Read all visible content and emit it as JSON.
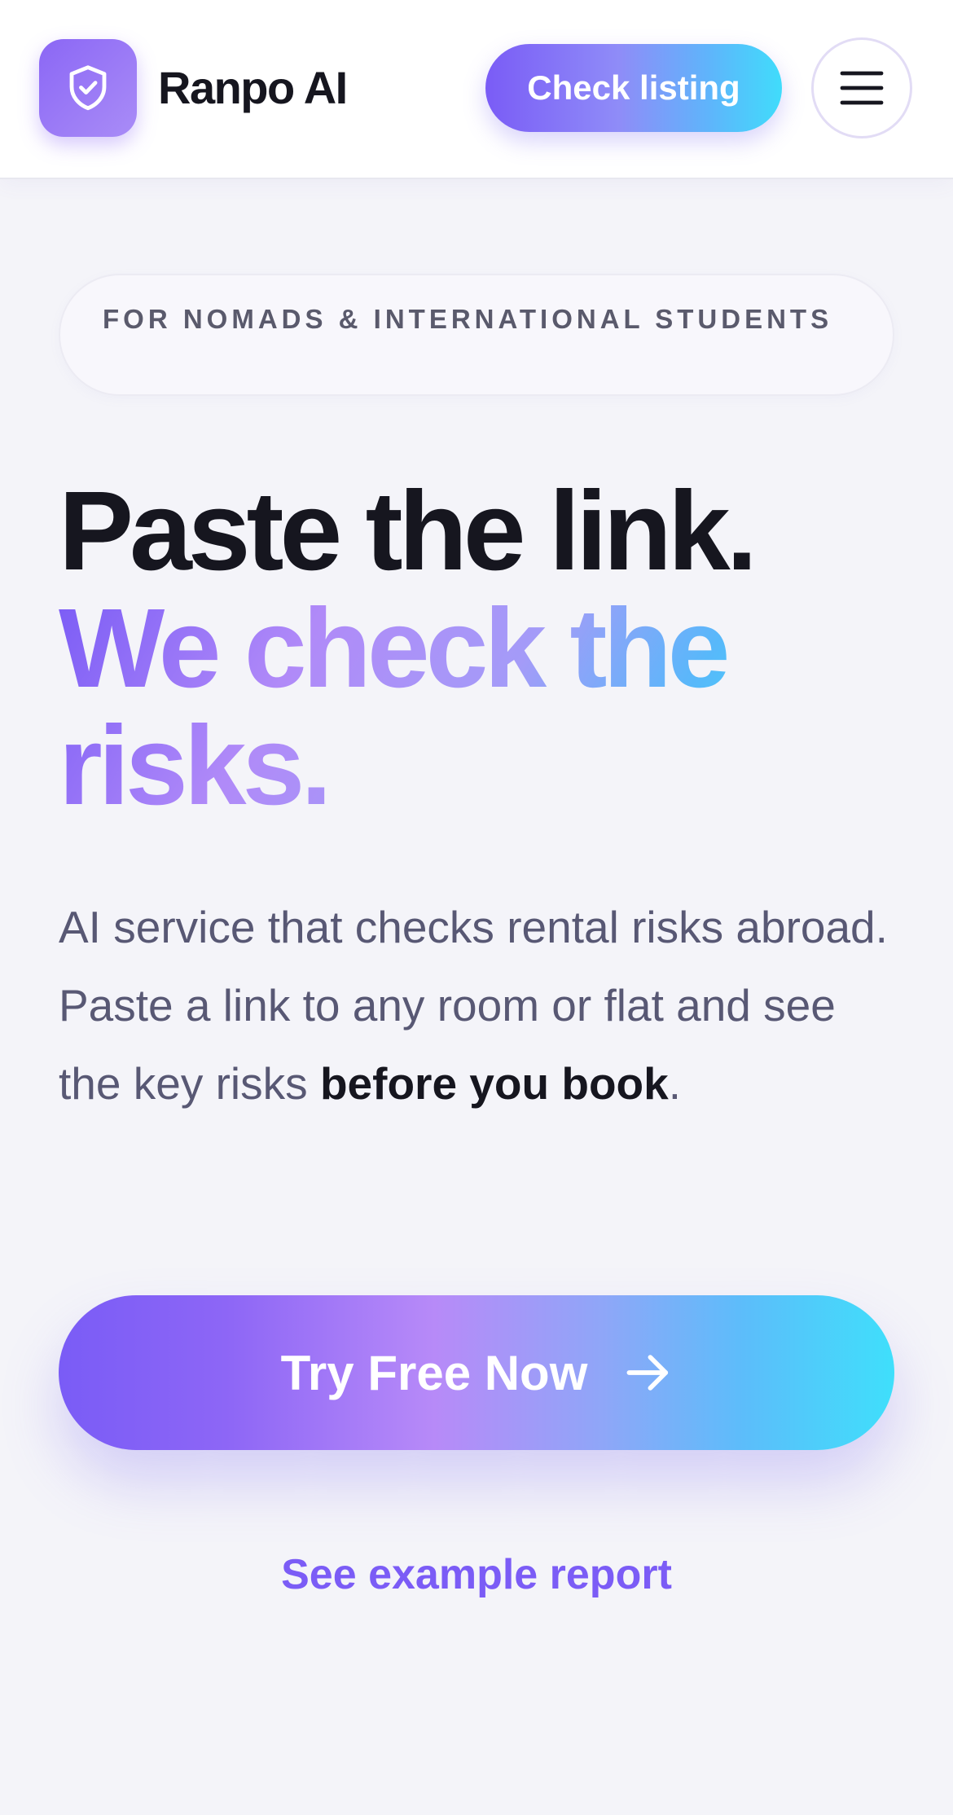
{
  "header": {
    "brand_name": "Ranpo AI",
    "logo_icon": "shield-check-icon",
    "check_listing_label": "Check listing",
    "menu_icon": "hamburger-menu-icon"
  },
  "badge": {
    "text": "FOR NOMADS & INTERNATIONAL STUDENTS"
  },
  "hero": {
    "title_line1": "Paste the link.",
    "title_line2": "We check the risks.",
    "description_prefix": "AI service that checks rental risks abroad. Paste a link to any room or flat and see the key risks ",
    "description_bold": "before you book",
    "description_suffix": "."
  },
  "cta": {
    "try_free_label": "Try Free Now",
    "arrow_icon": "arrow-right-icon",
    "example_link_label": "See example report"
  },
  "colors": {
    "accent_purple": "#7b5cf6",
    "accent_cyan": "#40dcfb",
    "background": "#f4f4f9",
    "text_dark": "#16161f",
    "text_muted": "#585874"
  }
}
